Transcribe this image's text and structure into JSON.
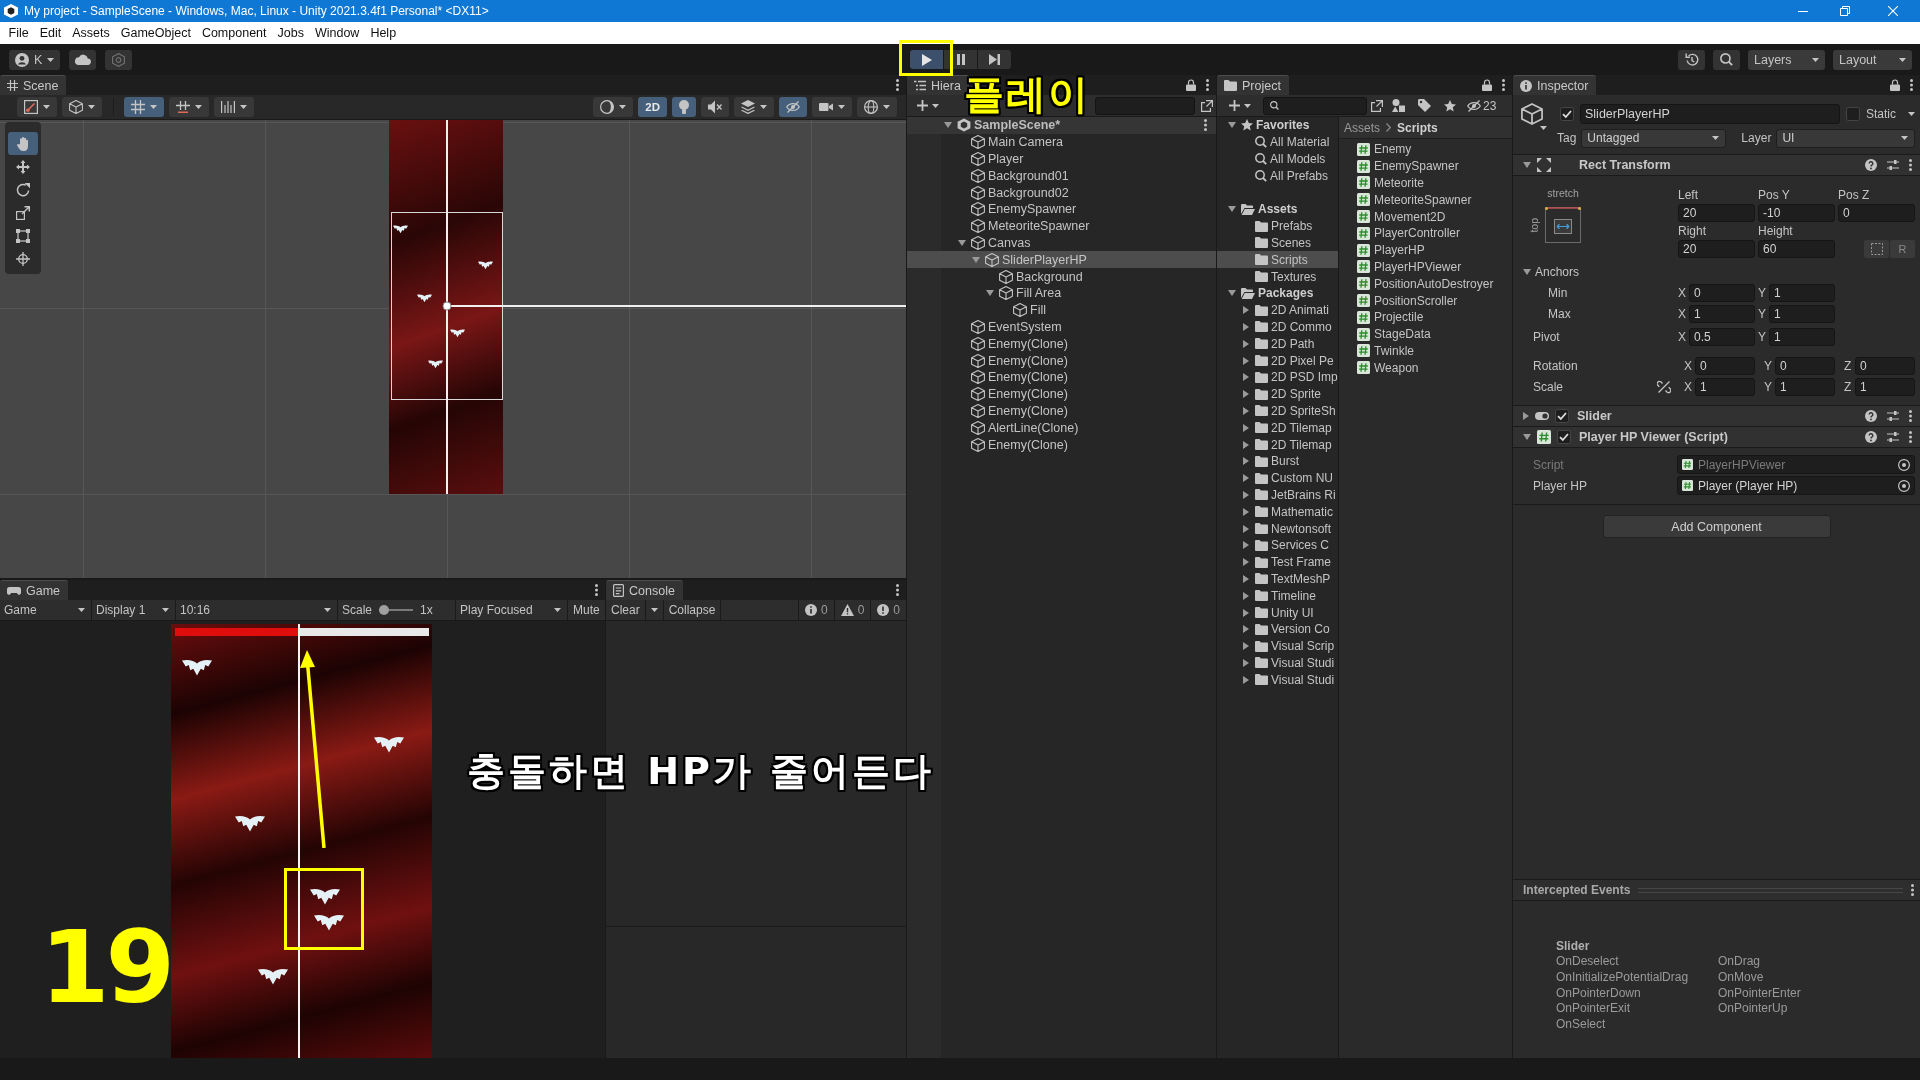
{
  "window": {
    "title": "My project - SampleScene - Windows, Mac, Linux - Unity 2021.3.4f1 Personal* <DX11>"
  },
  "menu_bar": [
    "File",
    "Edit",
    "Assets",
    "GameObject",
    "Component",
    "Jobs",
    "Window",
    "Help"
  ],
  "toolbar": {
    "account": "K",
    "play": {
      "on": true
    },
    "pause": {
      "on": false
    },
    "layers": "Layers",
    "layout": "Layout"
  },
  "scene": {
    "tab": "Scene",
    "left_toggles": [
      {
        "kind": "drawmode",
        "on": false
      },
      {
        "kind": "shading",
        "on": false
      },
      {
        "kind": "grid",
        "on": true
      },
      {
        "kind": "snap",
        "on": false
      },
      {
        "kind": "increment",
        "on": false
      }
    ],
    "right_toggles": [
      {
        "kind": "sphere",
        "on": false
      },
      {
        "kind": "dimension",
        "label": "2D",
        "on": true
      },
      {
        "kind": "lighting",
        "on": true
      },
      {
        "kind": "audio",
        "on": false
      },
      {
        "kind": "effects",
        "on": false
      },
      {
        "kind": "visibility",
        "on": true
      },
      {
        "kind": "camera",
        "on": false
      },
      {
        "kind": "gizmos",
        "on": false
      }
    ],
    "tools": [
      {
        "kind": "hand",
        "selected": true
      },
      {
        "kind": "move",
        "selected": false
      },
      {
        "kind": "rotate",
        "selected": false
      },
      {
        "kind": "scale",
        "selected": false
      },
      {
        "kind": "rect",
        "selected": false
      },
      {
        "kind": "transform",
        "selected": false
      }
    ]
  },
  "game": {
    "tab": "Game",
    "view_menu": "Game",
    "display": "Display 1",
    "aspect": "10:16",
    "scale_label": "Scale",
    "scale_slider": {
      "level": 0
    },
    "scale_value": "1x",
    "play_mode": "Play Focused",
    "mute": {
      "label": "Mute",
      "on": false
    },
    "hp_bar": {
      "level": 0.49
    }
  },
  "console": {
    "tab": "Console",
    "clear": "Clear",
    "collapse": {
      "label": "Collapse",
      "on": false
    },
    "counts": [
      {
        "kind": "info",
        "count": "0"
      },
      {
        "kind": "warning",
        "count": "0"
      },
      {
        "kind": "error",
        "count": "0"
      }
    ]
  },
  "hierarchy": {
    "tab": "Hiera",
    "items": [
      {
        "label": "SampleScene*",
        "kind": "scene",
        "expanded": true,
        "selected": false,
        "children": [
          {
            "label": "Main Camera",
            "selected": false
          },
          {
            "label": "Player",
            "selected": false
          },
          {
            "label": "Background01",
            "selected": false
          },
          {
            "label": "Background02",
            "selected": false
          },
          {
            "label": "EnemySpawner",
            "selected": false
          },
          {
            "label": "MeteoriteSpawner",
            "selected": false
          },
          {
            "label": "Canvas",
            "expanded": true,
            "selected": false,
            "children": [
              {
                "label": "SliderPlayerHP",
                "expanded": true,
                "selected": true,
                "children": [
                  {
                    "label": "Background",
                    "selected": false
                  },
                  {
                    "label": "Fill Area",
                    "expanded": true,
                    "selected": false,
                    "children": [
                      {
                        "label": "Fill",
                        "selected": false
                      }
                    ]
                  }
                ]
              }
            ]
          },
          {
            "label": "EventSystem",
            "selected": false
          },
          {
            "label": "Enemy(Clone)",
            "selected": false
          },
          {
            "label": "Enemy(Clone)",
            "selected": false
          },
          {
            "label": "Enemy(Clone)",
            "selected": false
          },
          {
            "label": "Enemy(Clone)",
            "selected": false
          },
          {
            "label": "Enemy(Clone)",
            "selected": false
          },
          {
            "label": "AlertLine(Clone)",
            "selected": false
          },
          {
            "label": "Enemy(Clone)",
            "selected": false
          }
        ]
      }
    ]
  },
  "project": {
    "tab": "Project",
    "hidden_count": "23",
    "tree": [
      {
        "label": "Favorites",
        "kind": "favorites",
        "expanded": true,
        "selected": false,
        "children": [
          {
            "label": "All Material",
            "kind": "search",
            "selected": false
          },
          {
            "label": "All Models",
            "kind": "search",
            "selected": false
          },
          {
            "label": "All Prefabs",
            "kind": "search",
            "selected": false
          }
        ]
      },
      {
        "label": "Assets",
        "kind": "root",
        "expanded": true,
        "selected": false,
        "children": [
          {
            "label": "Prefabs",
            "kind": "folder",
            "selected": false
          },
          {
            "label": "Scenes",
            "kind": "folder",
            "selected": false
          },
          {
            "label": "Scripts",
            "kind": "folder",
            "selected": true
          },
          {
            "label": "Textures",
            "kind": "folder",
            "selected": false
          }
        ]
      },
      {
        "label": "Packages",
        "kind": "root",
        "expanded": true,
        "selected": false,
        "children": [
          {
            "label": "2D Animati",
            "kind": "folder",
            "expanded": false,
            "selected": false
          },
          {
            "label": "2D Commo",
            "kind": "folder",
            "expanded": false,
            "selected": false
          },
          {
            "label": "2D Path",
            "kind": "folder",
            "expanded": false,
            "selected": false
          },
          {
            "label": "2D Pixel Pe",
            "kind": "folder",
            "expanded": false,
            "selected": false
          },
          {
            "label": "2D PSD Imp",
            "kind": "folder",
            "expanded": false,
            "selected": false
          },
          {
            "label": "2D Sprite",
            "kind": "folder",
            "expanded": false,
            "selected": false
          },
          {
            "label": "2D SpriteSh",
            "kind": "folder",
            "expanded": false,
            "selected": false
          },
          {
            "label": "2D Tilemap",
            "kind": "folder",
            "expanded": false,
            "selected": false
          },
          {
            "label": "2D Tilemap",
            "kind": "folder",
            "expanded": false,
            "selected": false
          },
          {
            "label": "Burst",
            "kind": "folder",
            "expanded": false,
            "selected": false
          },
          {
            "label": "Custom NU",
            "kind": "folder",
            "expanded": false,
            "selected": false
          },
          {
            "label": "JetBrains Ri",
            "kind": "folder",
            "expanded": false,
            "selected": false
          },
          {
            "label": "Mathematic",
            "kind": "folder",
            "expanded": false,
            "selected": false
          },
          {
            "label": "Newtonsoft",
            "kind": "folder",
            "expanded": false,
            "selected": false
          },
          {
            "label": "Services C",
            "kind": "folder",
            "expanded": false,
            "selected": false
          },
          {
            "label": "Test Frame",
            "kind": "folder",
            "expanded": false,
            "selected": false
          },
          {
            "label": "TextMeshP",
            "kind": "folder",
            "expanded": false,
            "selected": false
          },
          {
            "label": "Timeline",
            "kind": "folder",
            "expanded": false,
            "selected": false
          },
          {
            "label": "Unity UI",
            "kind": "folder",
            "expanded": false,
            "selected": false
          },
          {
            "label": "Version Co",
            "kind": "folder",
            "expanded": false,
            "selected": false
          },
          {
            "label": "Visual Scrip",
            "kind": "folder",
            "expanded": false,
            "selected": false
          },
          {
            "label": "Visual Studi",
            "kind": "folder",
            "expanded": false,
            "selected": false
          },
          {
            "label": "Visual Studi",
            "kind": "folder",
            "expanded": false,
            "selected": false
          }
        ]
      }
    ],
    "breadcrumb": [
      {
        "label": "Assets",
        "current": false
      },
      {
        "label": "Scripts",
        "current": true
      }
    ],
    "files": [
      {
        "label": "Enemy",
        "selected": false
      },
      {
        "label": "EnemySpawner",
        "selected": false
      },
      {
        "label": "Meteorite",
        "selected": false
      },
      {
        "label": "MeteoriteSpawner",
        "selected": false
      },
      {
        "label": "Movement2D",
        "selected": false
      },
      {
        "label": "PlayerController",
        "selected": false
      },
      {
        "label": "PlayerHP",
        "selected": false
      },
      {
        "label": "PlayerHPViewer",
        "selected": false
      },
      {
        "label": "PositionAutoDestroyer",
        "selected": false
      },
      {
        "label": "PositionScroller",
        "selected": false
      },
      {
        "label": "Projectile",
        "selected": false
      },
      {
        "label": "StageData",
        "selected": false
      },
      {
        "label": "Twinkle",
        "selected": false
      },
      {
        "label": "Weapon",
        "selected": false
      }
    ]
  },
  "inspector": {
    "tab": "Inspector",
    "object": {
      "active": true,
      "name": "SliderPlayerHP",
      "static": false,
      "static_label": "Static",
      "tag_label": "Tag",
      "tag": "Untagged",
      "layer_label": "Layer",
      "layer": "UI"
    },
    "rect_transform": {
      "title": "Rect Transform",
      "expanded": true,
      "anchor_h": "stretch",
      "anchor_v": "top",
      "fields": [
        {
          "label": "Left",
          "value": "20"
        },
        {
          "label": "Pos Y",
          "value": "-10"
        },
        {
          "label": "Pos Z",
          "value": "0"
        },
        {
          "label": "Right",
          "value": "20"
        },
        {
          "label": "Height",
          "value": "60"
        }
      ],
      "raw_button": "R",
      "anchors": {
        "label": "Anchors",
        "expanded": true,
        "rows": [
          {
            "label": "Min",
            "values": [
              {
                "axis": "X",
                "value": "0"
              },
              {
                "axis": "Y",
                "value": "1"
              }
            ]
          },
          {
            "label": "Max",
            "values": [
              {
                "axis": "X",
                "value": "1"
              },
              {
                "axis": "Y",
                "value": "1"
              }
            ]
          }
        ]
      },
      "pivot": {
        "label": "Pivot",
        "values": [
          {
            "axis": "X",
            "value": "0.5"
          },
          {
            "axis": "Y",
            "value": "1"
          }
        ]
      },
      "rotation": {
        "label": "Rotation",
        "values": [
          {
            "axis": "X",
            "value": "0"
          },
          {
            "axis": "Y",
            "value": "0"
          },
          {
            "axis": "Z",
            "value": "0"
          }
        ]
      },
      "scale": {
        "label": "Scale",
        "values": [
          {
            "axis": "X",
            "value": "1"
          },
          {
            "axis": "Y",
            "value": "1"
          },
          {
            "axis": "Z",
            "value": "1"
          }
        ]
      }
    },
    "components": [
      {
        "kind": "slider",
        "title": "Slider",
        "expanded": false,
        "enabled": true
      },
      {
        "kind": "script",
        "title": "Player HP Viewer (Script)",
        "expanded": true,
        "enabled": true,
        "properties": [
          {
            "label": "Script",
            "value": "PlayerHPViewer",
            "disabled": true
          },
          {
            "label": "Player HP",
            "value": "Player (Player HP)",
            "disabled": false
          }
        ]
      }
    ],
    "add_component": "Add Component",
    "events": {
      "title": "Intercepted Events",
      "source": "Slider",
      "items": [
        "OnDeselect",
        "OnDrag",
        "OnInitializePotentialDrag",
        "OnMove",
        "OnPointerDown",
        "OnPointerEnter",
        "OnPointerExit",
        "OnPointerUp",
        "OnSelect"
      ]
    }
  },
  "annotations": [
    {
      "kind": "label",
      "text": "플레이"
    },
    {
      "kind": "caption",
      "text": "충돌하면 HP가 줄어든다"
    },
    {
      "kind": "number",
      "text": "19"
    }
  ]
}
